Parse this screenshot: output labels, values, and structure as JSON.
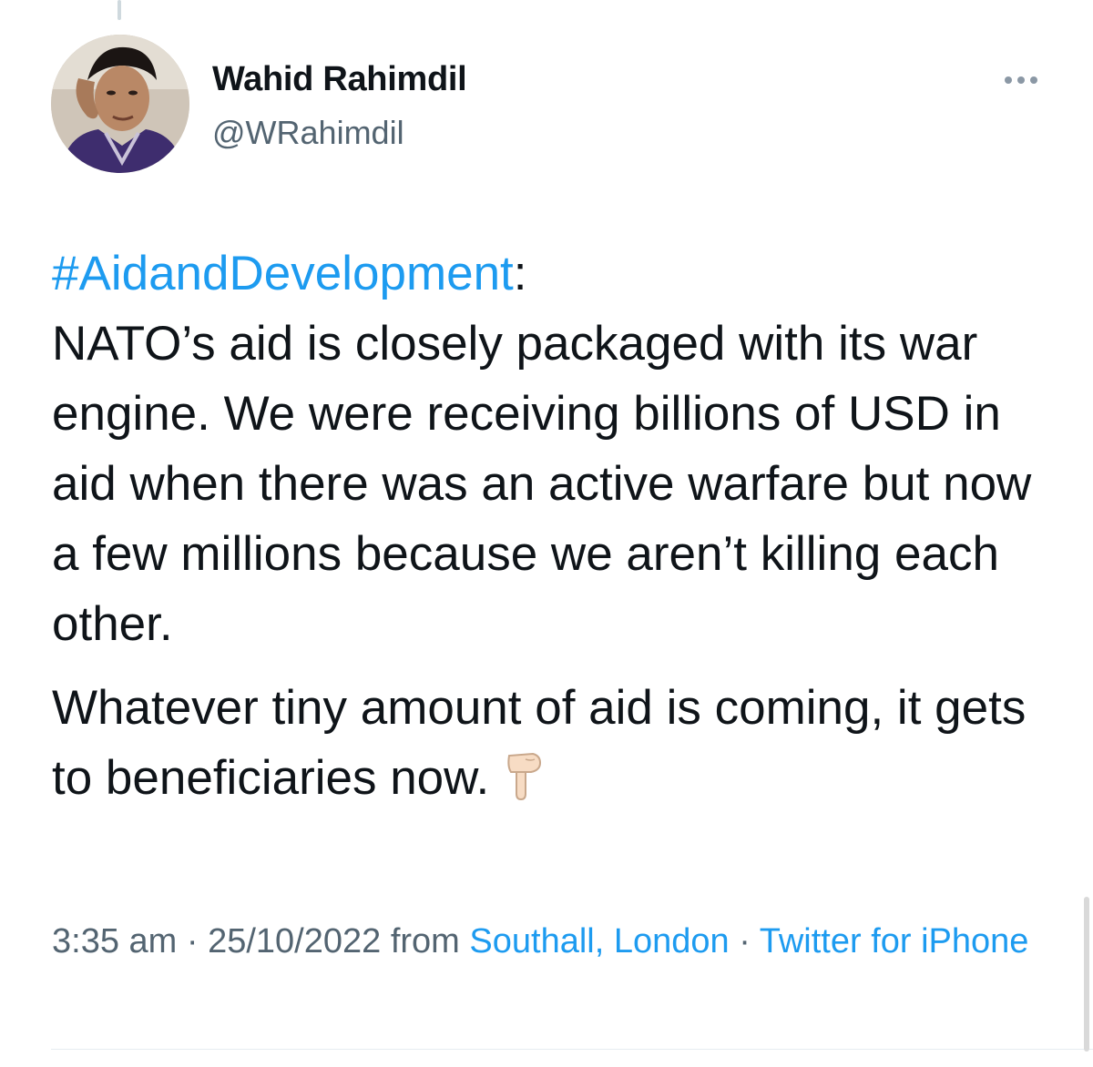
{
  "user": {
    "display_name": "Wahid Rahimdil",
    "handle": "@WRahimdil"
  },
  "tweet": {
    "hashtag": "#AidandDevelopment",
    "hashtag_suffix": ":",
    "paragraph1": "NATO’s aid is closely packaged with its war engine. We were receiving billions of USD in aid when there was an active warfare but now a few millions because we aren’t killing each other.",
    "paragraph2": "Whatever tiny amount of aid is coming, it gets to beneficiaries now.",
    "emoji": "backhand-index-pointing-down"
  },
  "meta": {
    "time": "3:35 am",
    "separator1": " · ",
    "date": "25/10/2022",
    "from_label": " from ",
    "location": "Southall, London",
    "separator2": " · ",
    "source": "Twitter for iPhone"
  },
  "colors": {
    "link": "#1d9bf0",
    "text": "#0f1419",
    "secondary": "#536471"
  },
  "icons": {
    "more": "more-horizontal-icon"
  }
}
